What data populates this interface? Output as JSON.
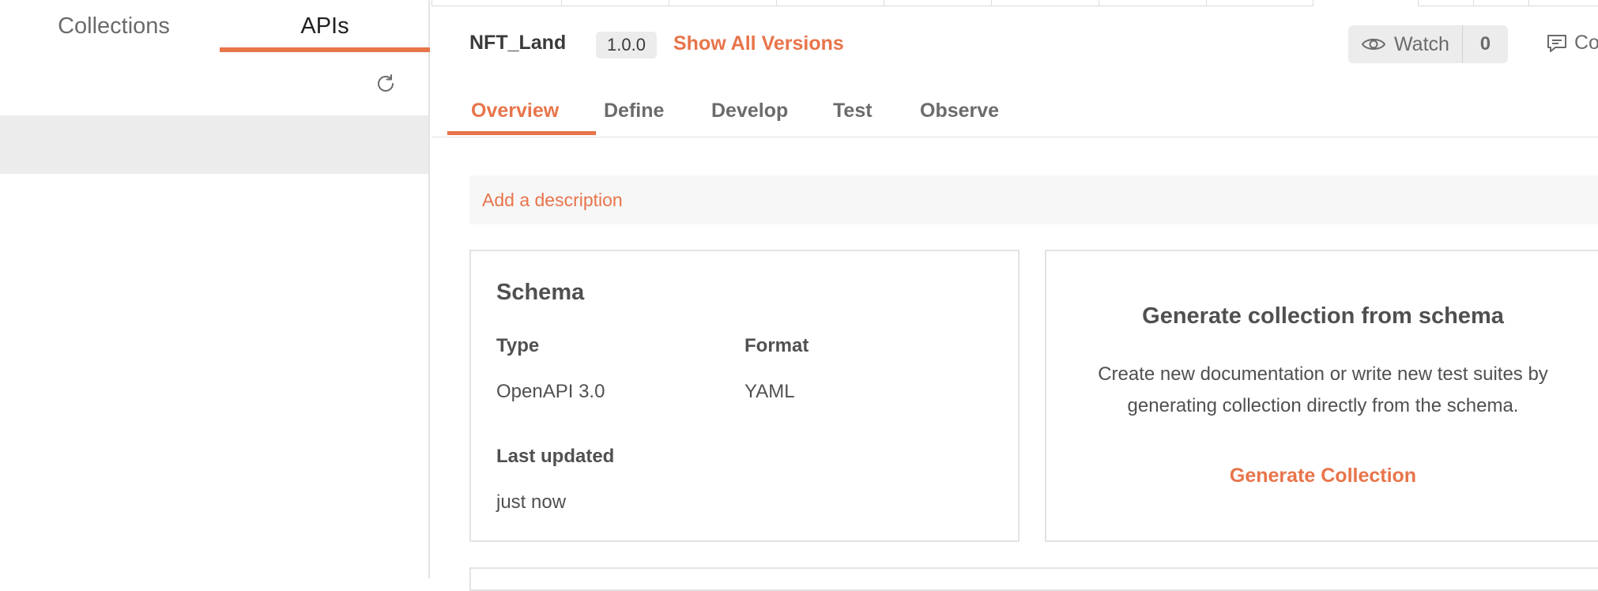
{
  "sidebar": {
    "tabs": [
      {
        "label": "Collections"
      },
      {
        "label": "APIs"
      }
    ],
    "refresh_icon": "refresh-icon"
  },
  "header": {
    "api_name": "NFT_Land",
    "version": "1.0.0",
    "show_versions": "Show All Versions",
    "watch_label": "Watch",
    "watch_count": "0",
    "comments_label": "Co"
  },
  "subtabs": [
    {
      "label": "Overview"
    },
    {
      "label": "Define"
    },
    {
      "label": "Develop"
    },
    {
      "label": "Test"
    },
    {
      "label": "Observe"
    }
  ],
  "description": {
    "placeholder": "Add a description"
  },
  "schema": {
    "title": "Schema",
    "type_label": "Type",
    "type_value": "OpenAPI 3.0",
    "format_label": "Format",
    "format_value": "YAML",
    "updated_label": "Last updated",
    "updated_value": "just now"
  },
  "generate": {
    "title": "Generate collection from schema",
    "description": "Create new documentation or write new test suites by generating collection directly from the schema.",
    "link": "Generate Collection"
  },
  "colors": {
    "accent": "#e8744a",
    "highlight": "#ececec"
  }
}
